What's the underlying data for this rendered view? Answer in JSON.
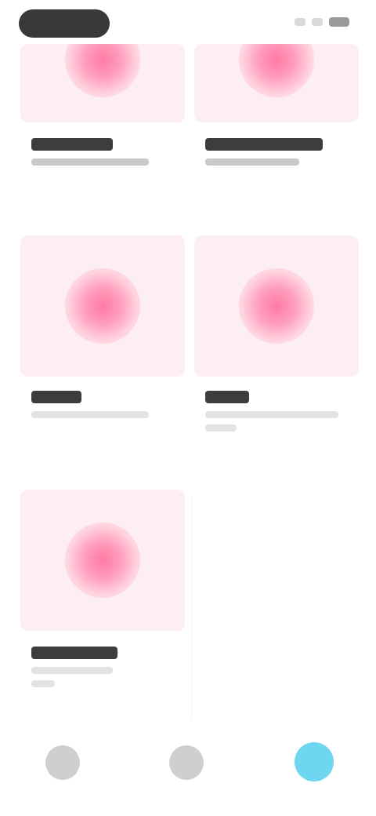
{
  "status_bar": {
    "time_pill_color": "#3a3838",
    "icons": [
      "signal-icon",
      "wifi-icon",
      "battery-icon"
    ]
  },
  "grid": {
    "thumbnail_background": "#fdeef1",
    "accent_color": "#ff7aa4",
    "cards": [
      {
        "title": "",
        "subtitle": "",
        "icon": "pink-blob-icon"
      },
      {
        "title": "",
        "subtitle": "",
        "icon": "pink-blob-icon"
      },
      {
        "title": "",
        "subtitle": "",
        "icon": "pink-blob-icon"
      },
      {
        "title": "",
        "subtitle": "",
        "icon": "pink-blob-icon"
      },
      {
        "title": "",
        "subtitle": "",
        "icon": "pink-blob-icon"
      }
    ]
  },
  "bottom_nav": {
    "active_color": "#6ed6ef",
    "items": [
      {
        "label": "",
        "icon": "home-icon",
        "active": false
      },
      {
        "label": "",
        "icon": "grid-icon",
        "active": false
      },
      {
        "label": "",
        "icon": "profile-icon",
        "active": true
      }
    ]
  }
}
